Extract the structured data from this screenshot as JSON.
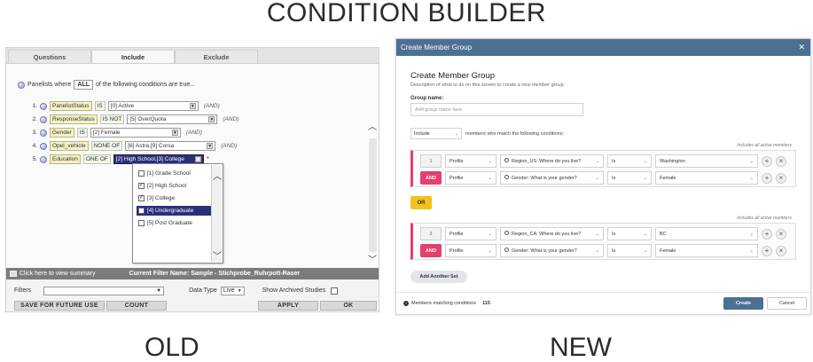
{
  "title": "CONDITION BUILDER",
  "captions": {
    "old": "OLD",
    "new": "NEW"
  },
  "old": {
    "tabs": [
      "Questions",
      "Include",
      "Exclude"
    ],
    "panelists_prefix": "Panelists where",
    "all": "ALL",
    "panelists_suffix": "of the following conditions are true...",
    "and_label": "(AND)",
    "conditions": [
      {
        "num": "1.",
        "field": "PanelistStatus",
        "op": "IS",
        "value": "[0] Active"
      },
      {
        "num": "2.",
        "field": "ResponseStatus",
        "op": "IS NOT",
        "value": "[5] OverQuota"
      },
      {
        "num": "3.",
        "field": "Gender",
        "op": "IS",
        "value": "[2] Female"
      },
      {
        "num": "4.",
        "field": "Opel_vehicle",
        "op": "NONE OF",
        "value": "[6] Astra,[9] Corsa"
      },
      {
        "num": "5.",
        "field": "Education",
        "op": "ONE OF",
        "value": "[2] High School,[3] College"
      }
    ],
    "required_mark": "*",
    "dropdown_items": [
      {
        "label": "[1] Grade School",
        "checked": false
      },
      {
        "label": "[2] High School",
        "checked": true
      },
      {
        "label": "[3] College",
        "checked": true
      },
      {
        "label": "[4] Undergraduate",
        "checked": false
      },
      {
        "label": "[5] Post Graduate",
        "checked": false
      }
    ],
    "summary_link": "Click here to view summary",
    "current_filter": "Current Filter Name: Sample - Stichprobe_Ruhrpott-Raser",
    "filters_label": "Filters",
    "data_type_label": "Data Type",
    "data_type_value": "Live",
    "archived_label": "Show Archived Studies",
    "buttons": {
      "save": "SAVE FOR FUTURE USE",
      "count": "COUNT",
      "apply": "APPLY",
      "ok": "OK"
    }
  },
  "new": {
    "header": "Create Member Group",
    "title": "Create Member Group",
    "description": "Description of what to do on this screen to create a new member group.",
    "group_name_label": "Group name:",
    "group_name_placeholder": "Add group name here",
    "include_value": "Include",
    "include_suffix": "members who match the following conditions:",
    "set_note": "Includes all active members",
    "sets": [
      {
        "number": "1",
        "rows": [
          {
            "type": "Profile",
            "question": "Region_US: Where do you live?",
            "op": "Is",
            "value": "Washington"
          },
          {
            "type": "Profile",
            "question": "Gender: What is your gender?",
            "op": "Is",
            "value": "Female"
          }
        ]
      },
      {
        "number": "2",
        "rows": [
          {
            "type": "Profile",
            "question": "Region_CA: Where do you live?",
            "op": "Is",
            "value": "BC"
          },
          {
            "type": "Profile",
            "question": "Gender: What is your gender?",
            "op": "Is",
            "value": "Female"
          }
        ]
      }
    ],
    "and_label": "AND",
    "or_label": "OR",
    "add_set": "Add Another Set",
    "matching_label": "Members matching conditions",
    "matching_count": "115",
    "create": "Create",
    "cancel": "Cancel"
  }
}
